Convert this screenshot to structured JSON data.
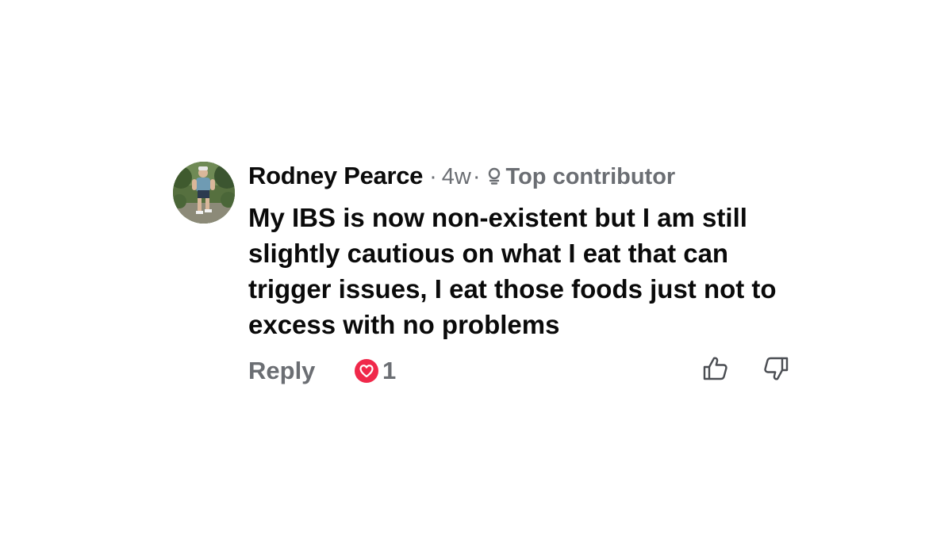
{
  "comment": {
    "author": "Rodney Pearce",
    "separator": "·",
    "age": "4w",
    "age_separator": "·",
    "badge": "Top contributor",
    "text": "My IBS is now non-existent but I am still slightly cautious on what I eat that can trigger issues, I eat those foods just not to excess with no problems",
    "reply_label": "Reply",
    "reaction_count": "1",
    "reaction_icon": "heart-icon",
    "colors": {
      "reaction": "#f0284a",
      "muted": "#6b6e73",
      "text": "#0a0a0a"
    }
  }
}
